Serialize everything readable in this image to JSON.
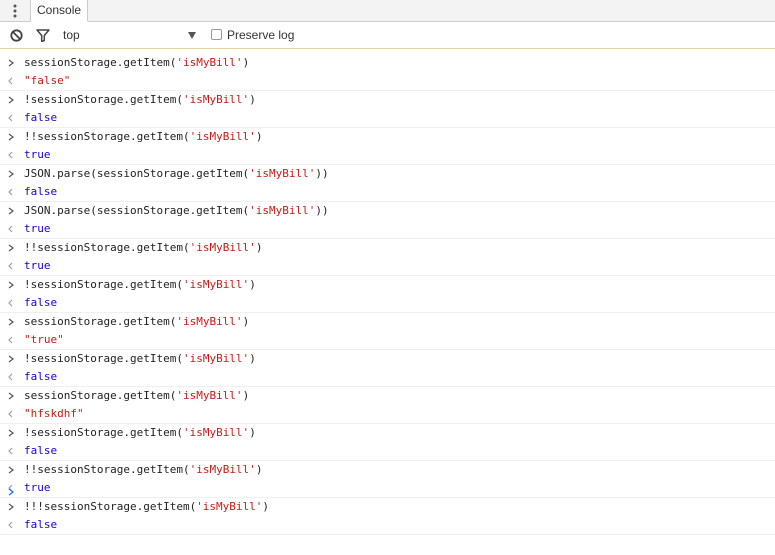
{
  "tabbar": {
    "tab_label": "Console"
  },
  "toolbar": {
    "context_value": "top",
    "preserve_log_label": "Preserve log",
    "preserve_log_checked": false
  },
  "colors": {
    "string": "#c41a16",
    "boolean": "#1c00cf",
    "text": "#222222",
    "marker": "#555555",
    "prompt_marker": "#1a73e8"
  },
  "entries": [
    {
      "pre": "sessionStorage.getItem(",
      "arg": "'isMyBill'",
      "post": ")",
      "result": "\"false\"",
      "kind": "string"
    },
    {
      "pre": "!sessionStorage.getItem(",
      "arg": "'isMyBill'",
      "post": ")",
      "result": "false",
      "kind": "boolean"
    },
    {
      "pre": "!!sessionStorage.getItem(",
      "arg": "'isMyBill'",
      "post": ")",
      "result": "true",
      "kind": "boolean"
    },
    {
      "pre": "JSON.parse(sessionStorage.getItem(",
      "arg": "'isMyBill'",
      "post": "))",
      "result": "false",
      "kind": "boolean"
    },
    {
      "pre": "JSON.parse(sessionStorage.getItem(",
      "arg": "'isMyBill'",
      "post": "))",
      "result": "true",
      "kind": "boolean"
    },
    {
      "pre": "!!sessionStorage.getItem(",
      "arg": "'isMyBill'",
      "post": ")",
      "result": "true",
      "kind": "boolean"
    },
    {
      "pre": "!sessionStorage.getItem(",
      "arg": "'isMyBill'",
      "post": ")",
      "result": "false",
      "kind": "boolean"
    },
    {
      "pre": "sessionStorage.getItem(",
      "arg": "'isMyBill'",
      "post": ")",
      "result": "\"true\"",
      "kind": "string"
    },
    {
      "pre": "!sessionStorage.getItem(",
      "arg": "'isMyBill'",
      "post": ")",
      "result": "false",
      "kind": "boolean"
    },
    {
      "pre": "sessionStorage.getItem(",
      "arg": "'isMyBill'",
      "post": ")",
      "result": "\"hfskdhf\"",
      "kind": "string"
    },
    {
      "pre": "!sessionStorage.getItem(",
      "arg": "'isMyBill'",
      "post": ")",
      "result": "false",
      "kind": "boolean"
    },
    {
      "pre": "!!sessionStorage.getItem(",
      "arg": "'isMyBill'",
      "post": ")",
      "result": "true",
      "kind": "boolean"
    },
    {
      "pre": "!!!sessionStorage.getItem(",
      "arg": "'isMyBill'",
      "post": ")",
      "result": "false",
      "kind": "boolean"
    }
  ],
  "prompt": {
    "value": ""
  }
}
